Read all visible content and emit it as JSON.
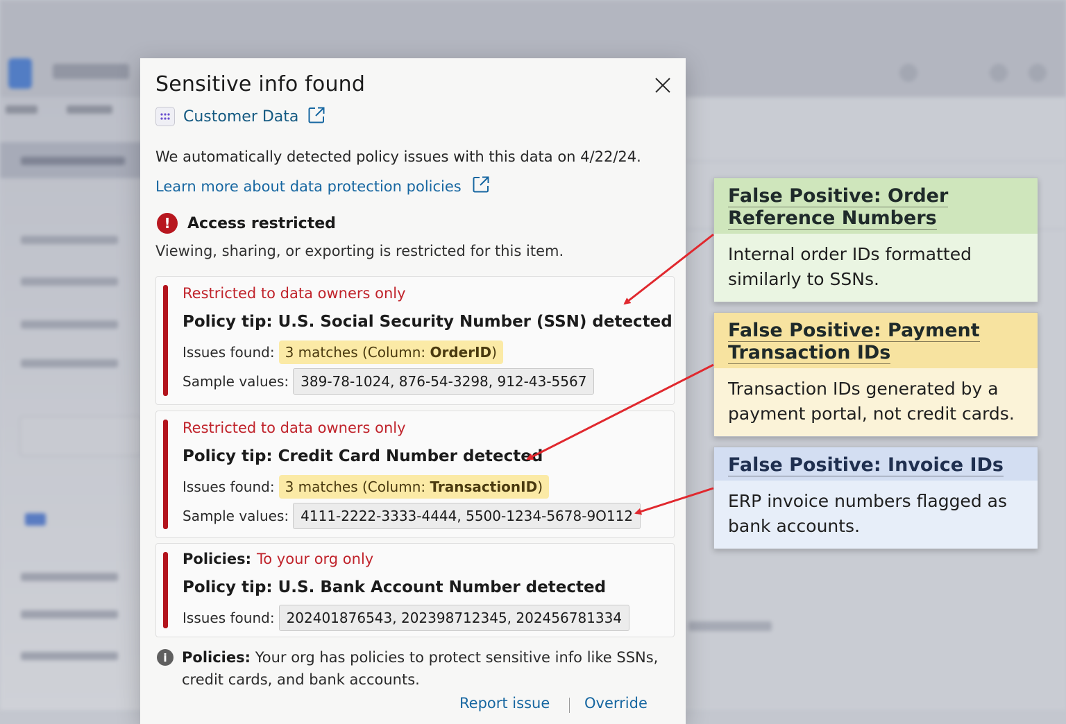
{
  "dialog": {
    "title": "Sensitive info found",
    "data_source": "Customer Data",
    "description": "We automatically detected policy issues with this data on 4/22/24.",
    "learn_more": "Learn more about data protection policies",
    "access": {
      "title": "Access restricted",
      "description": "Viewing, sharing, or exporting is restricted for this item."
    },
    "cards": [
      {
        "restriction": "Restricted to data owners only",
        "tip": "Policy tip: U.S. Social Security Number (SSN) detected",
        "issues_label": "Issues found:",
        "issues_prefix": "3 matches (Column: ",
        "issues_column": "OrderID",
        "issues_suffix": ")",
        "sample_label": "Sample values:",
        "sample_values": "389-78-1024, 876-54-3298, 912-43-5567"
      },
      {
        "restriction": "Restricted to data owners only",
        "tip": "Policy tip: Credit Card Number detected",
        "issues_label": "Issues found:",
        "issues_prefix": "3 matches (Column: ",
        "issues_column": "TransactionID",
        "issues_suffix": ")",
        "sample_label": "Sample values:",
        "sample_values": "4111-2222-3333-4444, 5500-1234-5678-9O112"
      },
      {
        "policies_label": "Policies:",
        "policies_value": "To your org only",
        "tip": "Policy tip: U.S. Bank Account Number detected",
        "issues_label": "Issues found:",
        "issues_values": "202401876543, 202398712345, 202456781334"
      }
    ],
    "footer_note_label": "Policies:",
    "footer_note_text": "Your org has policies to protect sensitive info like SSNs, credit cards, and bank accounts.",
    "report_issue": "Report issue",
    "override": "Override"
  },
  "callouts": [
    {
      "title": "False Positive: Order Reference Numbers",
      "body": "Internal order IDs formatted similarly to SSNs.",
      "color": "#cfe6bc"
    },
    {
      "title": "False Positive: Payment Transaction IDs",
      "body": "Transaction IDs generated by a payment portal, not credit cards.",
      "color": "#f7e3a0"
    },
    {
      "title": "False Positive: Invoice IDs",
      "body": "ERP invoice numbers flagged as bank accounts.",
      "color": "#d3def2"
    }
  ],
  "colors": {
    "accent_link": "#1767a1",
    "error_red": "#b3141d",
    "arrow_red": "#e0282e",
    "highlight_yellow": "#fbeaa6"
  },
  "icons": [
    "close-icon",
    "grid-dots-icon",
    "external-link-icon",
    "error-icon",
    "info-icon"
  ]
}
